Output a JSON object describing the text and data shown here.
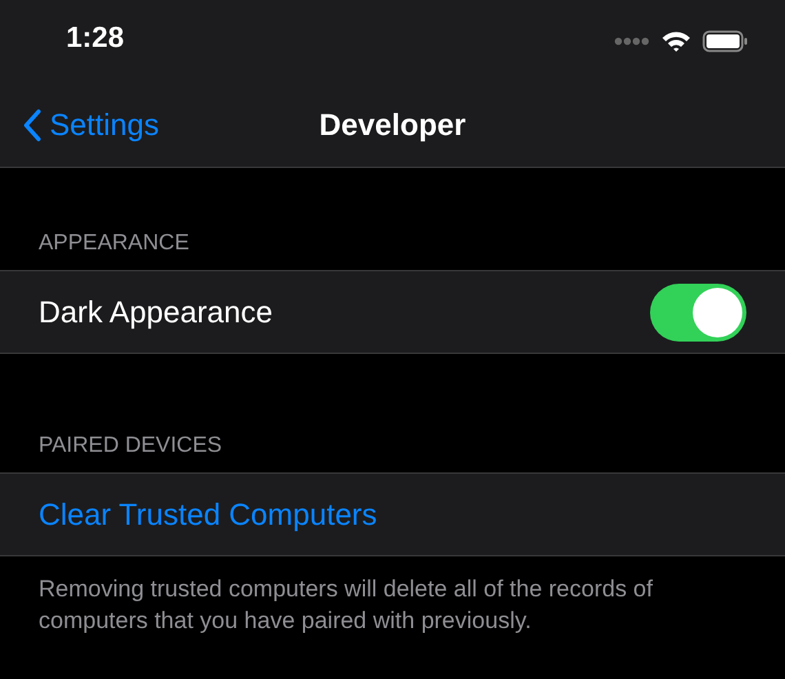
{
  "status_bar": {
    "time": "1:28"
  },
  "nav": {
    "back": "Settings",
    "title": "Developer"
  },
  "sections": [
    {
      "header": "APPEARANCE",
      "rows": [
        {
          "kind": "toggle",
          "label": "Dark Appearance",
          "on": true
        }
      ]
    },
    {
      "header": "PAIRED DEVICES",
      "rows": [
        {
          "kind": "action",
          "label": "Clear Trusted Computers"
        }
      ],
      "footer": "Removing trusted computers will delete all of the records of computers that you have paired with previously."
    }
  ]
}
